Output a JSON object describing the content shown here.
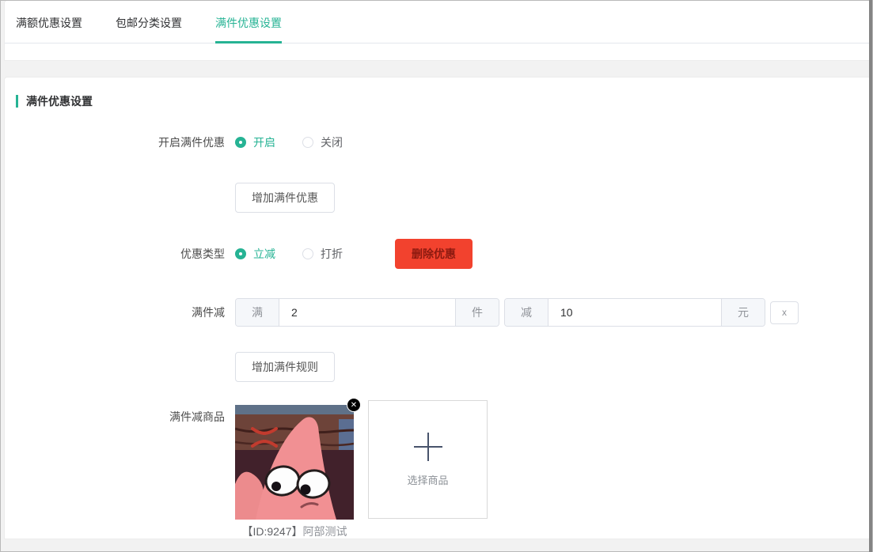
{
  "colors": {
    "accent": "#26b394",
    "danger_bg": "#f2422e",
    "danger_text": "#8c1a10"
  },
  "tabs": {
    "items": [
      {
        "label": "满额优惠设置",
        "active": false
      },
      {
        "label": "包邮分类设置",
        "active": false
      },
      {
        "label": "满件优惠设置",
        "active": true
      }
    ]
  },
  "section": {
    "title": "满件优惠设置"
  },
  "form": {
    "enable_row": {
      "label": "开启满件优惠",
      "option_on": "开启",
      "option_off": "关闭"
    },
    "add_discount_button": {
      "label": "增加满件优惠"
    },
    "type_row": {
      "label": "优惠类型",
      "option_reduce": "立减",
      "option_discount": "打折",
      "delete_button": "删除优惠"
    },
    "rule_row": {
      "label": "满件减",
      "qty_prefix": "满",
      "qty_value": "2",
      "qty_unit": "件",
      "amount_prefix": "减",
      "amount_value": "10",
      "amount_unit": "元",
      "remove_button": "x"
    },
    "add_rule_button": {
      "label": "增加满件规则"
    },
    "products_row": {
      "label": "满件减商品",
      "product_caption_id": "【ID:9247】",
      "product_caption_name": "阿部测试",
      "select_box_label": "选择商品"
    }
  }
}
